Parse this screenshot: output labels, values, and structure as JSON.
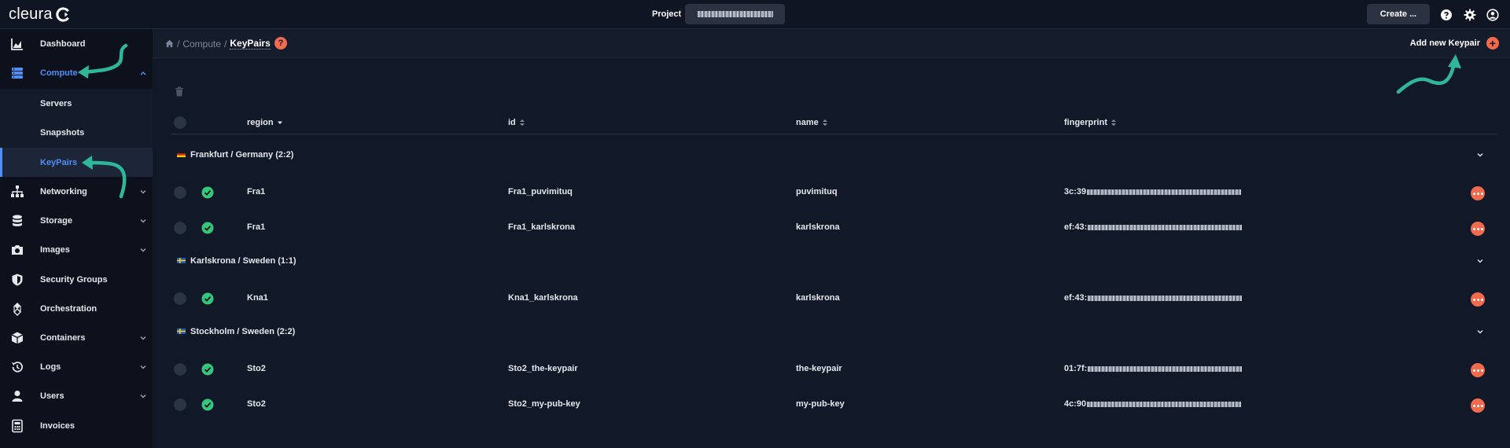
{
  "brand": {
    "name": "cleura"
  },
  "topbar": {
    "project_label": "Project",
    "create_label": "Create ...",
    "icons": [
      "help-icon",
      "settings-icon",
      "user-icon"
    ]
  },
  "sidebar": {
    "items": [
      {
        "label": "Dashboard",
        "icon": "chart-icon"
      },
      {
        "label": "Compute",
        "icon": "server-stack-icon",
        "expanded": true
      },
      {
        "label": "Networking",
        "icon": "network-icon"
      },
      {
        "label": "Storage",
        "icon": "database-icon"
      },
      {
        "label": "Images",
        "icon": "camera-icon"
      },
      {
        "label": "Security Groups",
        "icon": "shield-icon"
      },
      {
        "label": "Orchestration",
        "icon": "orchestration-icon"
      },
      {
        "label": "Containers",
        "icon": "box-icon"
      },
      {
        "label": "Logs",
        "icon": "history-icon"
      },
      {
        "label": "Users",
        "icon": "user-icon"
      },
      {
        "label": "Invoices",
        "icon": "calculator-icon"
      }
    ],
    "compute_children": [
      {
        "label": "Servers"
      },
      {
        "label": "Snapshots"
      },
      {
        "label": "KeyPairs",
        "active": true
      }
    ]
  },
  "breadcrumb": {
    "sep": "/",
    "parent": "Compute",
    "current": "KeyPairs"
  },
  "help_badge": "?",
  "add_keypair_label": "Add new Keypair",
  "table": {
    "columns": [
      "region",
      "id",
      "name",
      "fingerprint"
    ],
    "groups": [
      {
        "label": "Frankfurt / Germany (2:2)",
        "flag": "de",
        "rows": [
          {
            "region": "Fra1",
            "id": "Fra1_puvimituq",
            "name": "puvimituq",
            "fp_prefix": "3c:39"
          },
          {
            "region": "Fra1",
            "id": "Fra1_karlskrona",
            "name": "karlskrona",
            "fp_prefix": "ef:43:"
          }
        ]
      },
      {
        "label": "Karlskrona / Sweden (1:1)",
        "flag": "se",
        "rows": [
          {
            "region": "Kna1",
            "id": "Kna1_karlskrona",
            "name": "karlskrona",
            "fp_prefix": "ef:43:"
          }
        ]
      },
      {
        "label": "Stockholm / Sweden (2:2)",
        "flag": "se",
        "rows": [
          {
            "region": "Sto2",
            "id": "Sto2_the-keypair",
            "name": "the-keypair",
            "fp_prefix": "01:7f:"
          },
          {
            "region": "Sto2",
            "id": "Sto2_my-pub-key",
            "name": "my-pub-key",
            "fp_prefix": "4c:90"
          }
        ]
      }
    ]
  },
  "colors": {
    "accent": "#4f8ef7",
    "danger": "#f26b4f",
    "ok": "#34c77b",
    "annotation": "#2fb79a"
  }
}
